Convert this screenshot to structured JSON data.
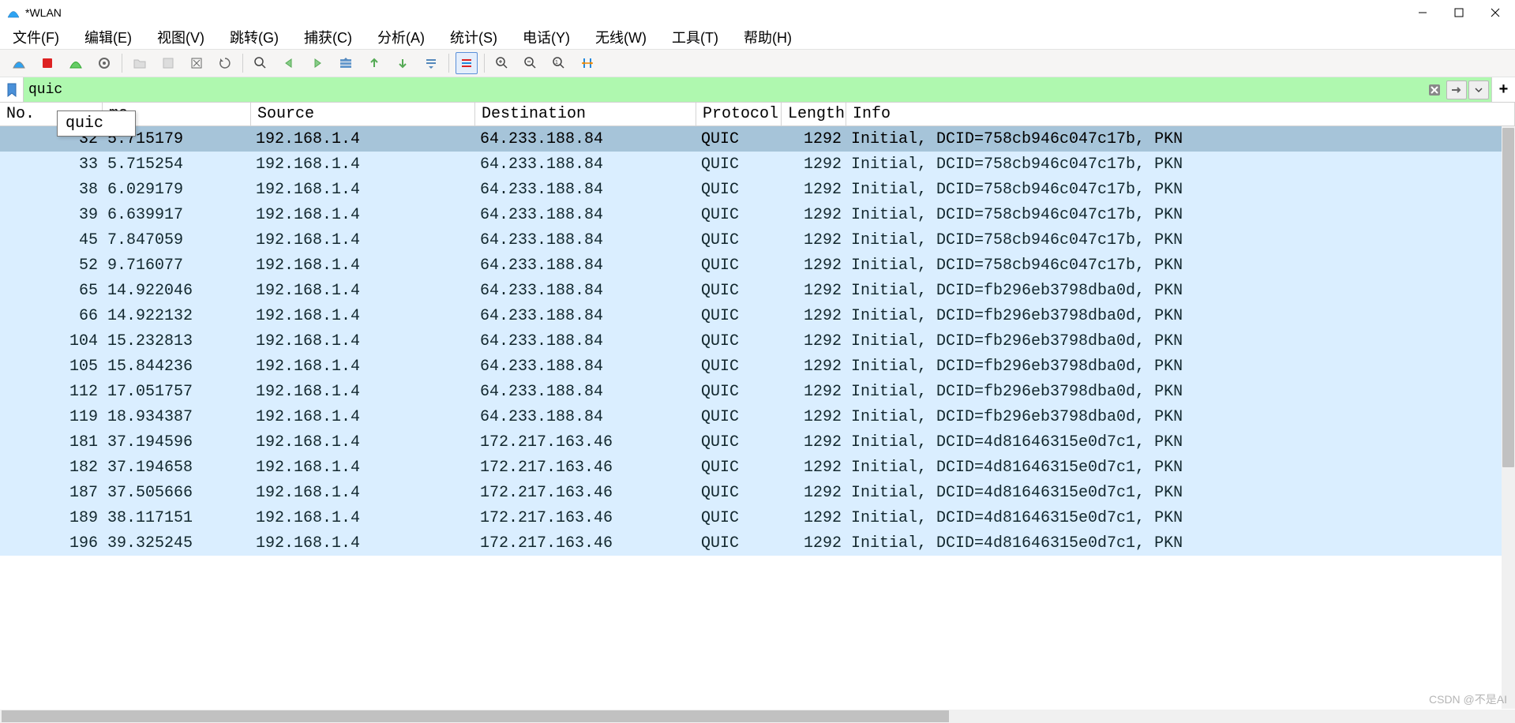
{
  "window": {
    "title": "*WLAN"
  },
  "menu": {
    "file": "文件(F)",
    "edit": "编辑(E)",
    "view": "视图(V)",
    "go": "跳转(G)",
    "capture": "捕获(C)",
    "analyze": "分析(A)",
    "stats": "统计(S)",
    "tele": "电话(Y)",
    "wireless": "无线(W)",
    "tools": "工具(T)",
    "help": "帮助(H)"
  },
  "filter": {
    "value": "quic",
    "suggestion": "quic"
  },
  "columns": {
    "no": "No.",
    "tm": "me",
    "src": "Source",
    "dst": "Destination",
    "pro": "Protocol",
    "len": "Length",
    "inf": "Info"
  },
  "packets": [
    {
      "no": "32",
      "tm": "5.715179",
      "src": "192.168.1.4",
      "dst": "64.233.188.84",
      "pro": "QUIC",
      "len": "1292",
      "inf": "Initial, DCID=758cb946c047c17b, PKN",
      "sel": true
    },
    {
      "no": "33",
      "tm": "5.715254",
      "src": "192.168.1.4",
      "dst": "64.233.188.84",
      "pro": "QUIC",
      "len": "1292",
      "inf": "Initial, DCID=758cb946c047c17b, PKN"
    },
    {
      "no": "38",
      "tm": "6.029179",
      "src": "192.168.1.4",
      "dst": "64.233.188.84",
      "pro": "QUIC",
      "len": "1292",
      "inf": "Initial, DCID=758cb946c047c17b, PKN"
    },
    {
      "no": "39",
      "tm": "6.639917",
      "src": "192.168.1.4",
      "dst": "64.233.188.84",
      "pro": "QUIC",
      "len": "1292",
      "inf": "Initial, DCID=758cb946c047c17b, PKN"
    },
    {
      "no": "45",
      "tm": "7.847059",
      "src": "192.168.1.4",
      "dst": "64.233.188.84",
      "pro": "QUIC",
      "len": "1292",
      "inf": "Initial, DCID=758cb946c047c17b, PKN"
    },
    {
      "no": "52",
      "tm": "9.716077",
      "src": "192.168.1.4",
      "dst": "64.233.188.84",
      "pro": "QUIC",
      "len": "1292",
      "inf": "Initial, DCID=758cb946c047c17b, PKN"
    },
    {
      "no": "65",
      "tm": "14.922046",
      "src": "192.168.1.4",
      "dst": "64.233.188.84",
      "pro": "QUIC",
      "len": "1292",
      "inf": "Initial, DCID=fb296eb3798dba0d, PKN"
    },
    {
      "no": "66",
      "tm": "14.922132",
      "src": "192.168.1.4",
      "dst": "64.233.188.84",
      "pro": "QUIC",
      "len": "1292",
      "inf": "Initial, DCID=fb296eb3798dba0d, PKN"
    },
    {
      "no": "104",
      "tm": "15.232813",
      "src": "192.168.1.4",
      "dst": "64.233.188.84",
      "pro": "QUIC",
      "len": "1292",
      "inf": "Initial, DCID=fb296eb3798dba0d, PKN"
    },
    {
      "no": "105",
      "tm": "15.844236",
      "src": "192.168.1.4",
      "dst": "64.233.188.84",
      "pro": "QUIC",
      "len": "1292",
      "inf": "Initial, DCID=fb296eb3798dba0d, PKN"
    },
    {
      "no": "112",
      "tm": "17.051757",
      "src": "192.168.1.4",
      "dst": "64.233.188.84",
      "pro": "QUIC",
      "len": "1292",
      "inf": "Initial, DCID=fb296eb3798dba0d, PKN"
    },
    {
      "no": "119",
      "tm": "18.934387",
      "src": "192.168.1.4",
      "dst": "64.233.188.84",
      "pro": "QUIC",
      "len": "1292",
      "inf": "Initial, DCID=fb296eb3798dba0d, PKN"
    },
    {
      "no": "181",
      "tm": "37.194596",
      "src": "192.168.1.4",
      "dst": "172.217.163.46",
      "pro": "QUIC",
      "len": "1292",
      "inf": "Initial, DCID=4d81646315e0d7c1, PKN"
    },
    {
      "no": "182",
      "tm": "37.194658",
      "src": "192.168.1.4",
      "dst": "172.217.163.46",
      "pro": "QUIC",
      "len": "1292",
      "inf": "Initial, DCID=4d81646315e0d7c1, PKN"
    },
    {
      "no": "187",
      "tm": "37.505666",
      "src": "192.168.1.4",
      "dst": "172.217.163.46",
      "pro": "QUIC",
      "len": "1292",
      "inf": "Initial, DCID=4d81646315e0d7c1, PKN"
    },
    {
      "no": "189",
      "tm": "38.117151",
      "src": "192.168.1.4",
      "dst": "172.217.163.46",
      "pro": "QUIC",
      "len": "1292",
      "inf": "Initial, DCID=4d81646315e0d7c1, PKN"
    },
    {
      "no": "196",
      "tm": "39.325245",
      "src": "192.168.1.4",
      "dst": "172.217.163.46",
      "pro": "QUIC",
      "len": "1292",
      "inf": "Initial, DCID=4d81646315e0d7c1, PKN"
    }
  ],
  "watermark": "CSDN @不是AI"
}
